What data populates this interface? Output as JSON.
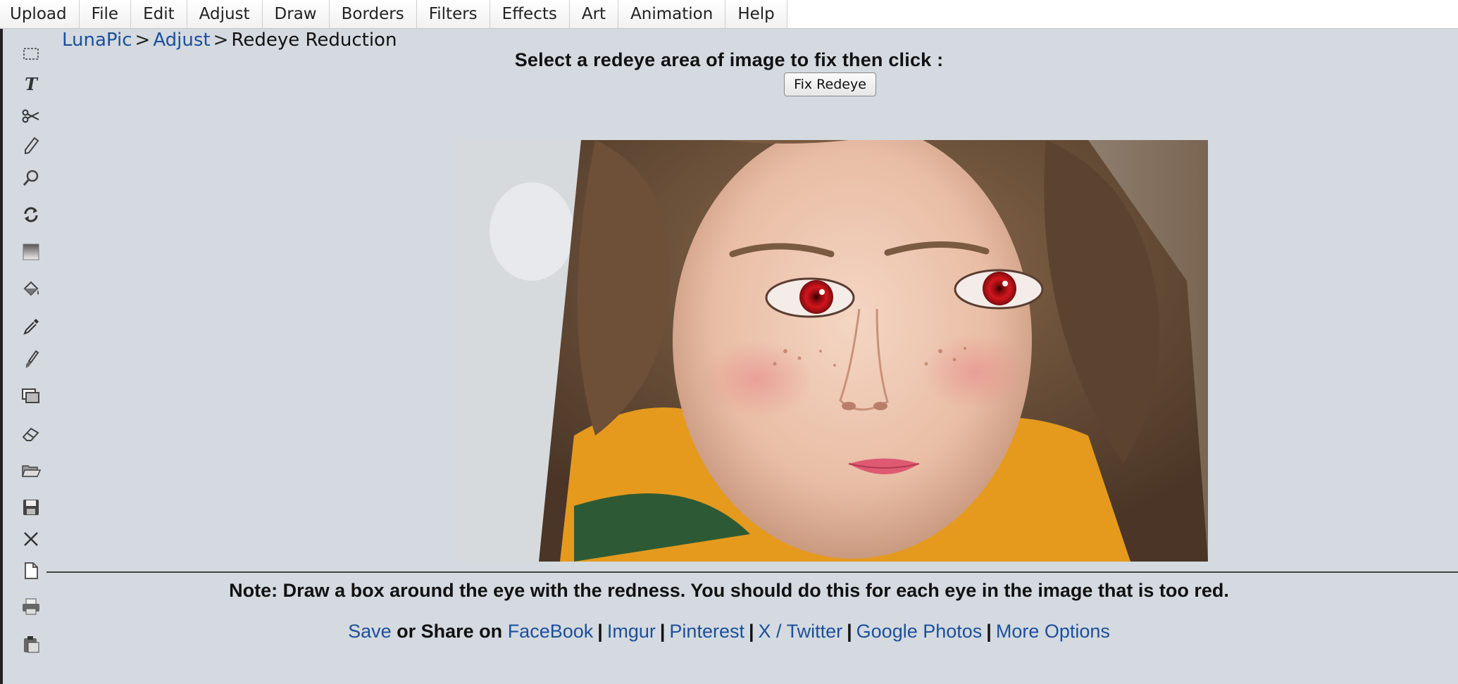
{
  "menu": {
    "items": [
      "Upload",
      "File",
      "Edit",
      "Adjust",
      "Draw",
      "Borders",
      "Filters",
      "Effects",
      "Art",
      "Animation",
      "Help"
    ]
  },
  "tools": [
    {
      "name": "select-rectangle-icon"
    },
    {
      "name": "text-tool-icon"
    },
    {
      "name": "scissors-icon"
    },
    {
      "name": "pencil-icon"
    },
    {
      "name": "magnifier-icon"
    },
    {
      "name": "rotate-icon"
    },
    {
      "name": "gradient-icon"
    },
    {
      "name": "paint-bucket-icon"
    },
    {
      "name": "eyedropper-icon"
    },
    {
      "name": "brush-icon"
    },
    {
      "name": "layers-icon"
    },
    {
      "name": "eraser-icon"
    },
    {
      "name": "open-folder-icon"
    },
    {
      "name": "save-disk-icon"
    },
    {
      "name": "close-x-icon"
    },
    {
      "name": "new-page-icon"
    },
    {
      "name": "print-icon"
    },
    {
      "name": "clipboard-paste-icon"
    }
  ],
  "breadcrumb": {
    "home": "LunaPic",
    "section": "Adjust",
    "current": "Redeye Reduction",
    "separator": ">"
  },
  "main": {
    "instruction": "Select a redeye area of image to fix then click :",
    "fix_button": "Fix Redeye",
    "photo_alt": "Portrait of girl with red eyes",
    "note": "Note: Draw a box around the eye with the redness. You should do this for each eye in the image that is too red."
  },
  "share": {
    "save": "Save",
    "or_share": "or Share on",
    "links": [
      "FaceBook",
      "Imgur",
      "Pinterest",
      "X / Twitter",
      "Google Photos",
      "More Options"
    ],
    "separator": "|"
  },
  "colors": {
    "background": "#d4dae0",
    "link": "#1c4f9c",
    "red_eye": "#c0141a"
  }
}
